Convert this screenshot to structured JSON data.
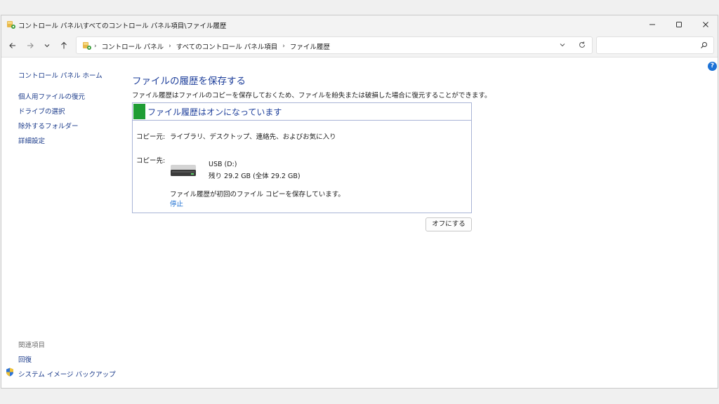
{
  "window": {
    "title": "コントロール パネル\\すべてのコントロール パネル項目\\ファイル履歴"
  },
  "address": {
    "crumbs": [
      "コントロール パネル",
      "すべてのコントロール パネル項目",
      "ファイル履歴"
    ],
    "separator": "›"
  },
  "search": {
    "placeholder": ""
  },
  "help": {
    "label": "?"
  },
  "sidebar": {
    "home": "コントロール パネル ホーム",
    "items": [
      "個人用ファイルの復元",
      "ドライブの選択",
      "除外するフォルダー",
      "詳細設定"
    ]
  },
  "related": {
    "label": "関連項目",
    "items": [
      "回復",
      "システム イメージ バックアップ"
    ]
  },
  "main": {
    "title": "ファイルの履歴を保存する",
    "description": "ファイル履歴はファイルのコピーを保存しておくため、ファイルを紛失または破損した場合に復元することができます。",
    "status_title": "ファイル履歴はオンになっています",
    "copy_source_label": "コピー元:",
    "copy_source_value": "ライブラリ、デスクトップ、連絡先、およびお気に入り",
    "copy_dest_label": "コピー先:",
    "drive_name": "USB (D:)",
    "drive_space": "残り 29.2 GB (全体 29.2 GB)",
    "status_message": "ファイル履歴が初回のファイル コピーを保存しています。",
    "stop_link": "停止",
    "off_button": "オフにする"
  },
  "colors": {
    "accent_title": "#1e3f9b",
    "status_green": "#1f9d34",
    "link": "#1c6fd1",
    "help_blue": "#1c72d6"
  }
}
